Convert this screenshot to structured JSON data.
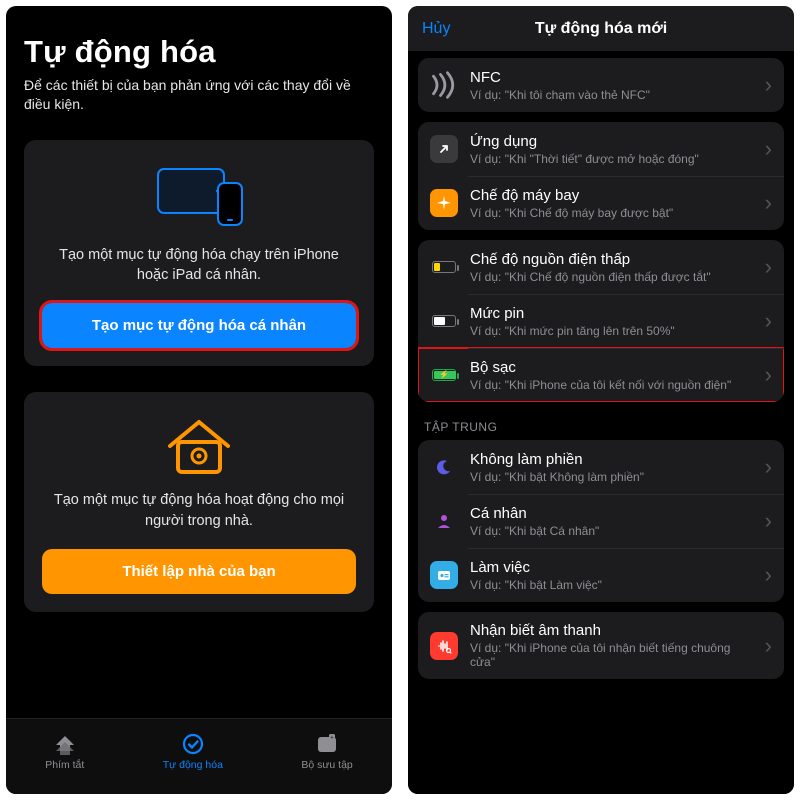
{
  "colors": {
    "accent": "#0a84ff",
    "orange": "#ff9500",
    "bg_card": "#1c1c1e",
    "highlight": "#e01616"
  },
  "left": {
    "title": "Tự động hóa",
    "subtitle": "Để các thiết bị của bạn phản ứng với các thay đổi về điều kiện.",
    "personal": {
      "desc": "Tạo một mục tự động hóa chạy trên iPhone hoặc iPad cá nhân.",
      "button": "Tạo mục tự động hóa cá nhân"
    },
    "home": {
      "desc": "Tạo một mục tự động hóa hoạt động cho mọi người trong nhà.",
      "button": "Thiết lập nhà của bạn"
    },
    "tabs": {
      "shortcuts": "Phím tắt",
      "automation": "Tự động hóa",
      "gallery": "Bộ sưu tập"
    }
  },
  "right": {
    "cancel": "Hủy",
    "title": "Tự động hóa mới",
    "sections": {
      "focus_header": "TẬP TRUNG"
    },
    "rows": {
      "nfc": {
        "name": "NFC",
        "ex": "Ví dụ: \"Khi tôi chạm vào thẻ NFC\""
      },
      "app": {
        "name": "Ứng dụng",
        "ex": "Ví dụ: \"Khi \"Thời tiết\" được mở hoặc đóng\""
      },
      "airplane": {
        "name": "Chế độ máy bay",
        "ex": "Ví dụ: \"Khi Chế độ máy bay được bật\""
      },
      "lowpower": {
        "name": "Chế độ nguồn điện thấp",
        "ex": "Ví dụ: \"Khi Chế độ nguồn điện thấp được tắt\""
      },
      "battery": {
        "name": "Mức pin",
        "ex": "Ví dụ: \"Khi mức pin tăng lên trên 50%\""
      },
      "charger": {
        "name": "Bộ sạc",
        "ex": "Ví dụ: \"Khi iPhone của tôi kết nối với nguồn điện\""
      },
      "dnd": {
        "name": "Không làm phiền",
        "ex": "Ví dụ: \"Khi bật Không làm phiền\""
      },
      "personal": {
        "name": "Cá nhân",
        "ex": "Ví dụ: \"Khi bật Cá nhân\""
      },
      "work": {
        "name": "Làm việc",
        "ex": "Ví dụ: \"Khi bật Làm việc\""
      },
      "sound": {
        "name": "Nhận biết âm thanh",
        "ex": "Ví dụ: \"Khi iPhone của tôi nhận biết tiếng chuông cửa\""
      }
    }
  }
}
